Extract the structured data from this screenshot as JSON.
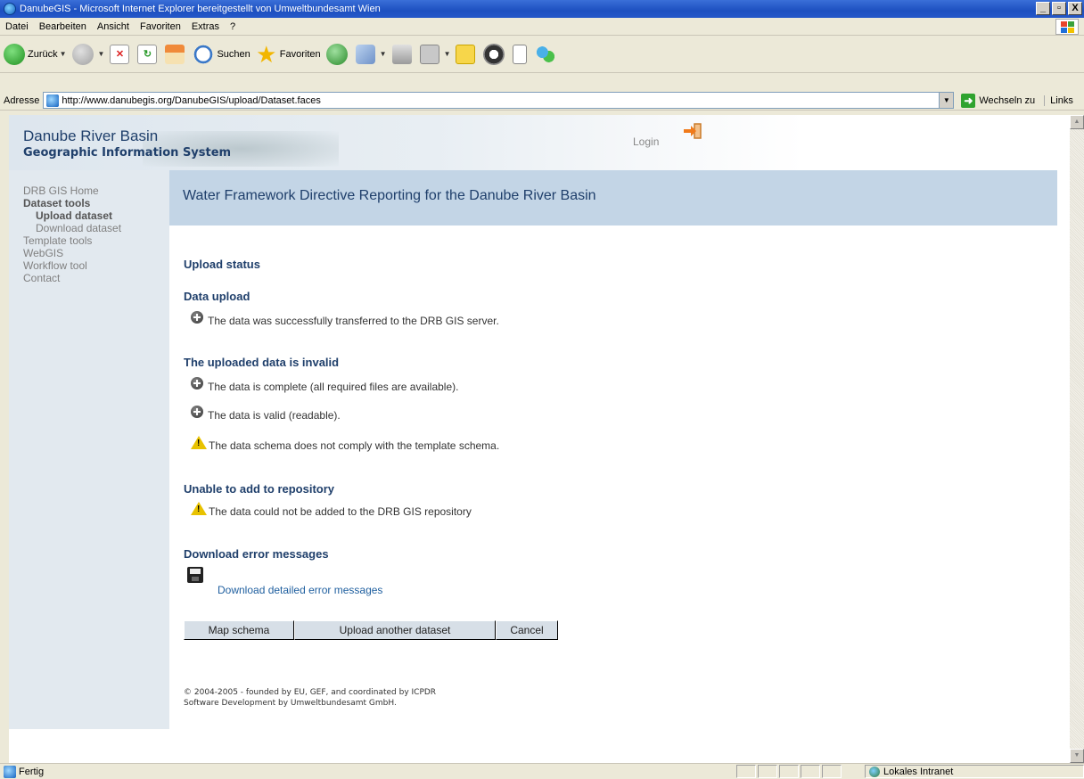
{
  "window": {
    "title": "DanubeGIS - Microsoft Internet Explorer bereitgestellt von Umweltbundesamt Wien",
    "controls": [
      "_",
      "▫",
      "X"
    ]
  },
  "menubar": {
    "items": [
      "Datei",
      "Bearbeiten",
      "Ansicht",
      "Favoriten",
      "Extras",
      "?"
    ]
  },
  "toolbar": {
    "back_label": "Zurück",
    "search_label": "Suchen",
    "favorites_label": "Favoriten"
  },
  "address": {
    "label": "Adresse",
    "url": "http://www.danubegis.org/DanubeGIS/upload/Dataset.faces",
    "go_label": "Wechseln zu",
    "links_label": "Links"
  },
  "page": {
    "header": {
      "title": "Danube River Basin",
      "subtitle": "Geographic Information System",
      "login": "Login"
    },
    "nav": {
      "items": [
        "DRB GIS Home",
        "Dataset tools",
        "Upload dataset",
        "Download dataset",
        "Template tools",
        "WebGIS",
        "Workflow tool",
        "Contact"
      ]
    },
    "banner": "Water Framework Directive Reporting for the Danube River Basin",
    "upload_status": "Upload status",
    "data_upload": {
      "heading": "Data upload",
      "messages": [
        "The data was successfully transferred to the DRB GIS server."
      ]
    },
    "invalid": {
      "heading": "The uploaded data is invalid",
      "messages": [
        "The data is complete (all required files are available).",
        "The data is valid (readable).",
        "The data schema does not comply with the template schema."
      ]
    },
    "repository": {
      "heading": "Unable to add to repository",
      "messages": [
        "The data could not be added to the DRB GIS repository"
      ]
    },
    "errors": {
      "heading": "Download error messages",
      "link": "Download detailed error messages"
    },
    "buttons": {
      "map_schema": "Map schema",
      "upload_another": "Upload another dataset",
      "cancel": "Cancel"
    },
    "footer": {
      "line1": "© 2004-2005 - founded by EU, GEF, and coordinated by ICPDR",
      "line2": "Software Development by Umweltbundesamt GmbH."
    }
  },
  "statusbar": {
    "text": "Fertig",
    "zone": "Lokales Intranet"
  }
}
